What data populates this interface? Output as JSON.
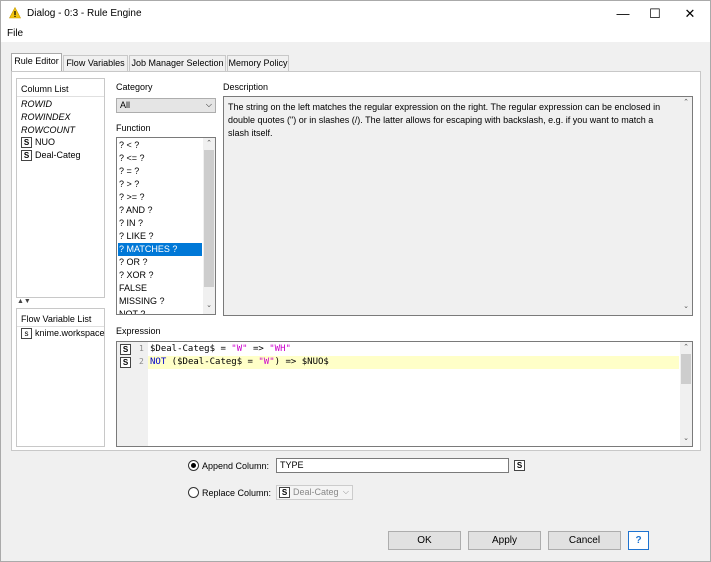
{
  "window": {
    "title": "Dialog - 0:3 - Rule Engine",
    "minimize": "—",
    "maximize": "☐",
    "close": "✕"
  },
  "menu": {
    "file": "File"
  },
  "tabs": [
    "Rule Editor",
    "Flow Variables",
    "Job Manager Selection",
    "Memory Policy"
  ],
  "column_list": {
    "title": "Column List",
    "items": [
      {
        "label": "ROWID",
        "italic": true
      },
      {
        "label": "ROWINDEX",
        "italic": true
      },
      {
        "label": "ROWCOUNT",
        "italic": true
      },
      {
        "label": "NUO",
        "badge": "S"
      },
      {
        "label": "Deal-Categ",
        "badge": "S"
      }
    ]
  },
  "flow_variable_list": {
    "title": "Flow Variable List",
    "items": [
      {
        "label": "knime.workspace",
        "badge": "s"
      }
    ]
  },
  "category": {
    "label": "Category",
    "value": "All"
  },
  "function": {
    "label": "Function",
    "items": [
      "? < ?",
      "? <= ?",
      "? = ?",
      "? > ?",
      "? >= ?",
      "? AND ?",
      "? IN ?",
      "? LIKE ?",
      "? MATCHES ?",
      "? OR ?",
      "? XOR ?",
      "FALSE",
      "MISSING ?",
      "NOT ?"
    ],
    "selected": "? MATCHES ?"
  },
  "description": {
    "label": "Description",
    "text": "The string on the left matches the regular expression on the right. The regular expression can be enclosed in double quotes (\") or in slashes (/). The latter allows for escaping with backslash, e.g. if you want to match a slash itself."
  },
  "expression": {
    "label": "Expression",
    "lines": [
      {
        "num": "1",
        "parts": [
          {
            "t": "$Deal-Categ$ = ",
            "c": ""
          },
          {
            "t": "\"W\"",
            "c": "str"
          },
          {
            "t": " => ",
            "c": ""
          },
          {
            "t": "\"WH\"",
            "c": "str"
          }
        ]
      },
      {
        "num": "2",
        "parts": [
          {
            "t": "NOT",
            "c": "kw"
          },
          {
            "t": " ($Deal-Categ$ = ",
            "c": ""
          },
          {
            "t": "\"W\"",
            "c": "str"
          },
          {
            "t": ") => $NUO$",
            "c": ""
          }
        ]
      }
    ]
  },
  "append_column": {
    "label": "Append Column:",
    "value": "TYPE",
    "badge": "S"
  },
  "replace_column": {
    "label": "Replace Column:",
    "value": "Deal-Categ",
    "badge": "S"
  },
  "buttons": {
    "ok": "OK",
    "apply": "Apply",
    "cancel": "Cancel",
    "help": "?"
  },
  "colors": {
    "selection": "#0078d7",
    "current_line": "#ffffc8",
    "help": "#1e73d0",
    "warning": "#f2c511"
  }
}
